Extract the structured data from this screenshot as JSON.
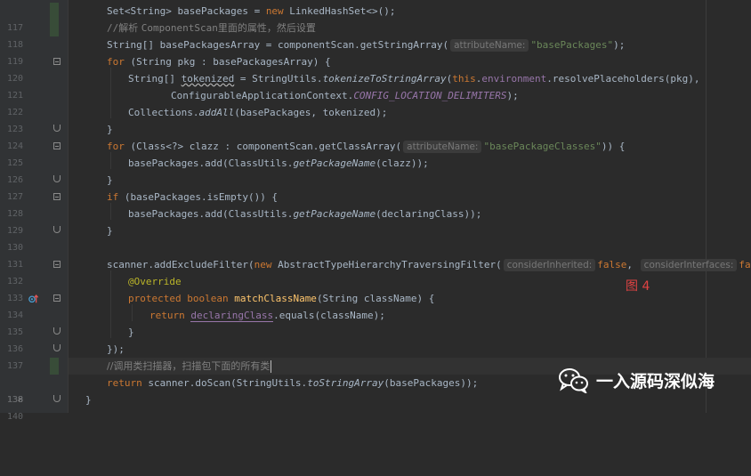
{
  "gutter": {
    "line_numbers": [
      "117",
      "118",
      "119",
      "120",
      "121",
      "122",
      "123",
      "124",
      "125",
      "126",
      "127",
      "128",
      "129",
      "130",
      "131",
      "132",
      "133",
      "134",
      "135",
      "136",
      "137",
      "138",
      "139",
      "140"
    ]
  },
  "code": {
    "l117": {
      "a": "Set<String> basePackages = ",
      "kw_new": "new",
      "b": " LinkedHashSet<>();"
    },
    "l118": {
      "slashes": "//",
      "cn1": "解析 ",
      "mono": "ComponentScan",
      "cn2": "里面的属性，然后设置"
    },
    "l119": {
      "a": "String[] basePackagesArray = componentScan.getStringArray(",
      "hint": "attributeName:",
      "str": "\"basePackages\"",
      "b": ");"
    },
    "l120": {
      "kw_for": "for",
      "a": " (String pkg : basePackagesArray) {"
    },
    "l121": {
      "a": "String[] ",
      "tokenized": "tokenized",
      "b": " = StringUtils.",
      "m": "tokenizeToStringArray",
      "c": "(",
      "kw_this": "this",
      "d": ".",
      "fld": "environment",
      "e": ".resolvePlaceholders(pkg),"
    },
    "l122": {
      "a": "ConfigurableApplicationContext.",
      "stc": "CONFIG_LOCATION_DELIMITERS",
      "b": ");"
    },
    "l123": {
      "a": "Collections.",
      "m": "addAll",
      "b": "(basePackages, tokenized);"
    },
    "l124": {
      "a": "}"
    },
    "l125": {
      "kw_for": "for",
      "a": " (Class<?> clazz : componentScan.getClassArray(",
      "hint": "attributeName:",
      "str": "\"basePackageClasses\"",
      "b": ")) {"
    },
    "l126": {
      "a": "basePackages.add(ClassUtils.",
      "m": "getPackageName",
      "b": "(clazz));"
    },
    "l127": {
      "a": "}"
    },
    "l128": {
      "kw_if": "if",
      "a": " (basePackages.isEmpty()) {"
    },
    "l129": {
      "a": "basePackages.add(ClassUtils.",
      "m": "getPackageName",
      "b": "(declaringClass));"
    },
    "l130": {
      "a": "}"
    },
    "l132": {
      "a": "scanner.addExcludeFilter(",
      "kw_new": "new",
      "b": " AbstractTypeHierarchyTraversingFilter(",
      "hint1": "considerInherited:",
      "kw_false1": "false",
      "c": ",",
      "hint2": "considerInterfaces:",
      "kw_false2": "false",
      "d": ") {"
    },
    "l133": {
      "ann": "@Override"
    },
    "l134": {
      "kw_protected": "protected",
      "kw_boolean": "boolean",
      "name": "matchClassName",
      "a": "(String className) {"
    },
    "l135": {
      "kw_return": "return",
      "u": "declaringClass",
      "a": ".equals(className);"
    },
    "l136": {
      "a": "}"
    },
    "l137": {
      "a": "});"
    },
    "l138": {
      "cmt": "//调用类扫描器，扫描包下面的所有类"
    },
    "l139": {
      "kw_return": "return",
      "a": " scanner.doScan(StringUtils.",
      "m": "toStringArray",
      "b": "(basePackages));"
    },
    "l140": {
      "a": "}"
    }
  },
  "figure_label": "图 4",
  "watermark": {
    "text": "一入源码深似海",
    "icon": "wechat-icon"
  },
  "colors": {
    "background": "#2b2b2b",
    "keyword": "#cc7832",
    "string": "#6a8759",
    "comment": "#808080",
    "annotation": "#bbb529",
    "field": "#9876aa",
    "figure_label": "#e04343"
  }
}
